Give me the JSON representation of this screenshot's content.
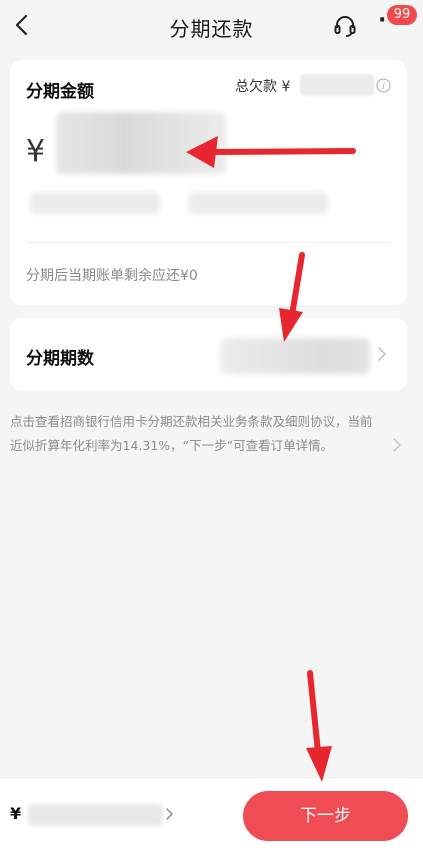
{
  "nav": {
    "title": "分期还款",
    "badge": "99"
  },
  "amount_card": {
    "label": "分期金额",
    "debt_label": "总欠款 ¥",
    "currency": "¥",
    "remain_text": "分期后当期账单剩余应还¥0"
  },
  "periods_card": {
    "label": "分期期数"
  },
  "notice": {
    "text": "点击查看招商银行信用卡分期还款相关业务条款及细则协议，当前近似折算年化利率为14.31%，“下一步”可查看订单详情。"
  },
  "bottom_bar": {
    "currency": "¥",
    "next_label": "下一步"
  },
  "colors": {
    "accent": "#ef4c53",
    "annotation_arrow": "#e8262f"
  },
  "icons": [
    "back-arrow-icon",
    "headset-icon",
    "more-icon",
    "info-icon",
    "chevron-right-icon"
  ]
}
